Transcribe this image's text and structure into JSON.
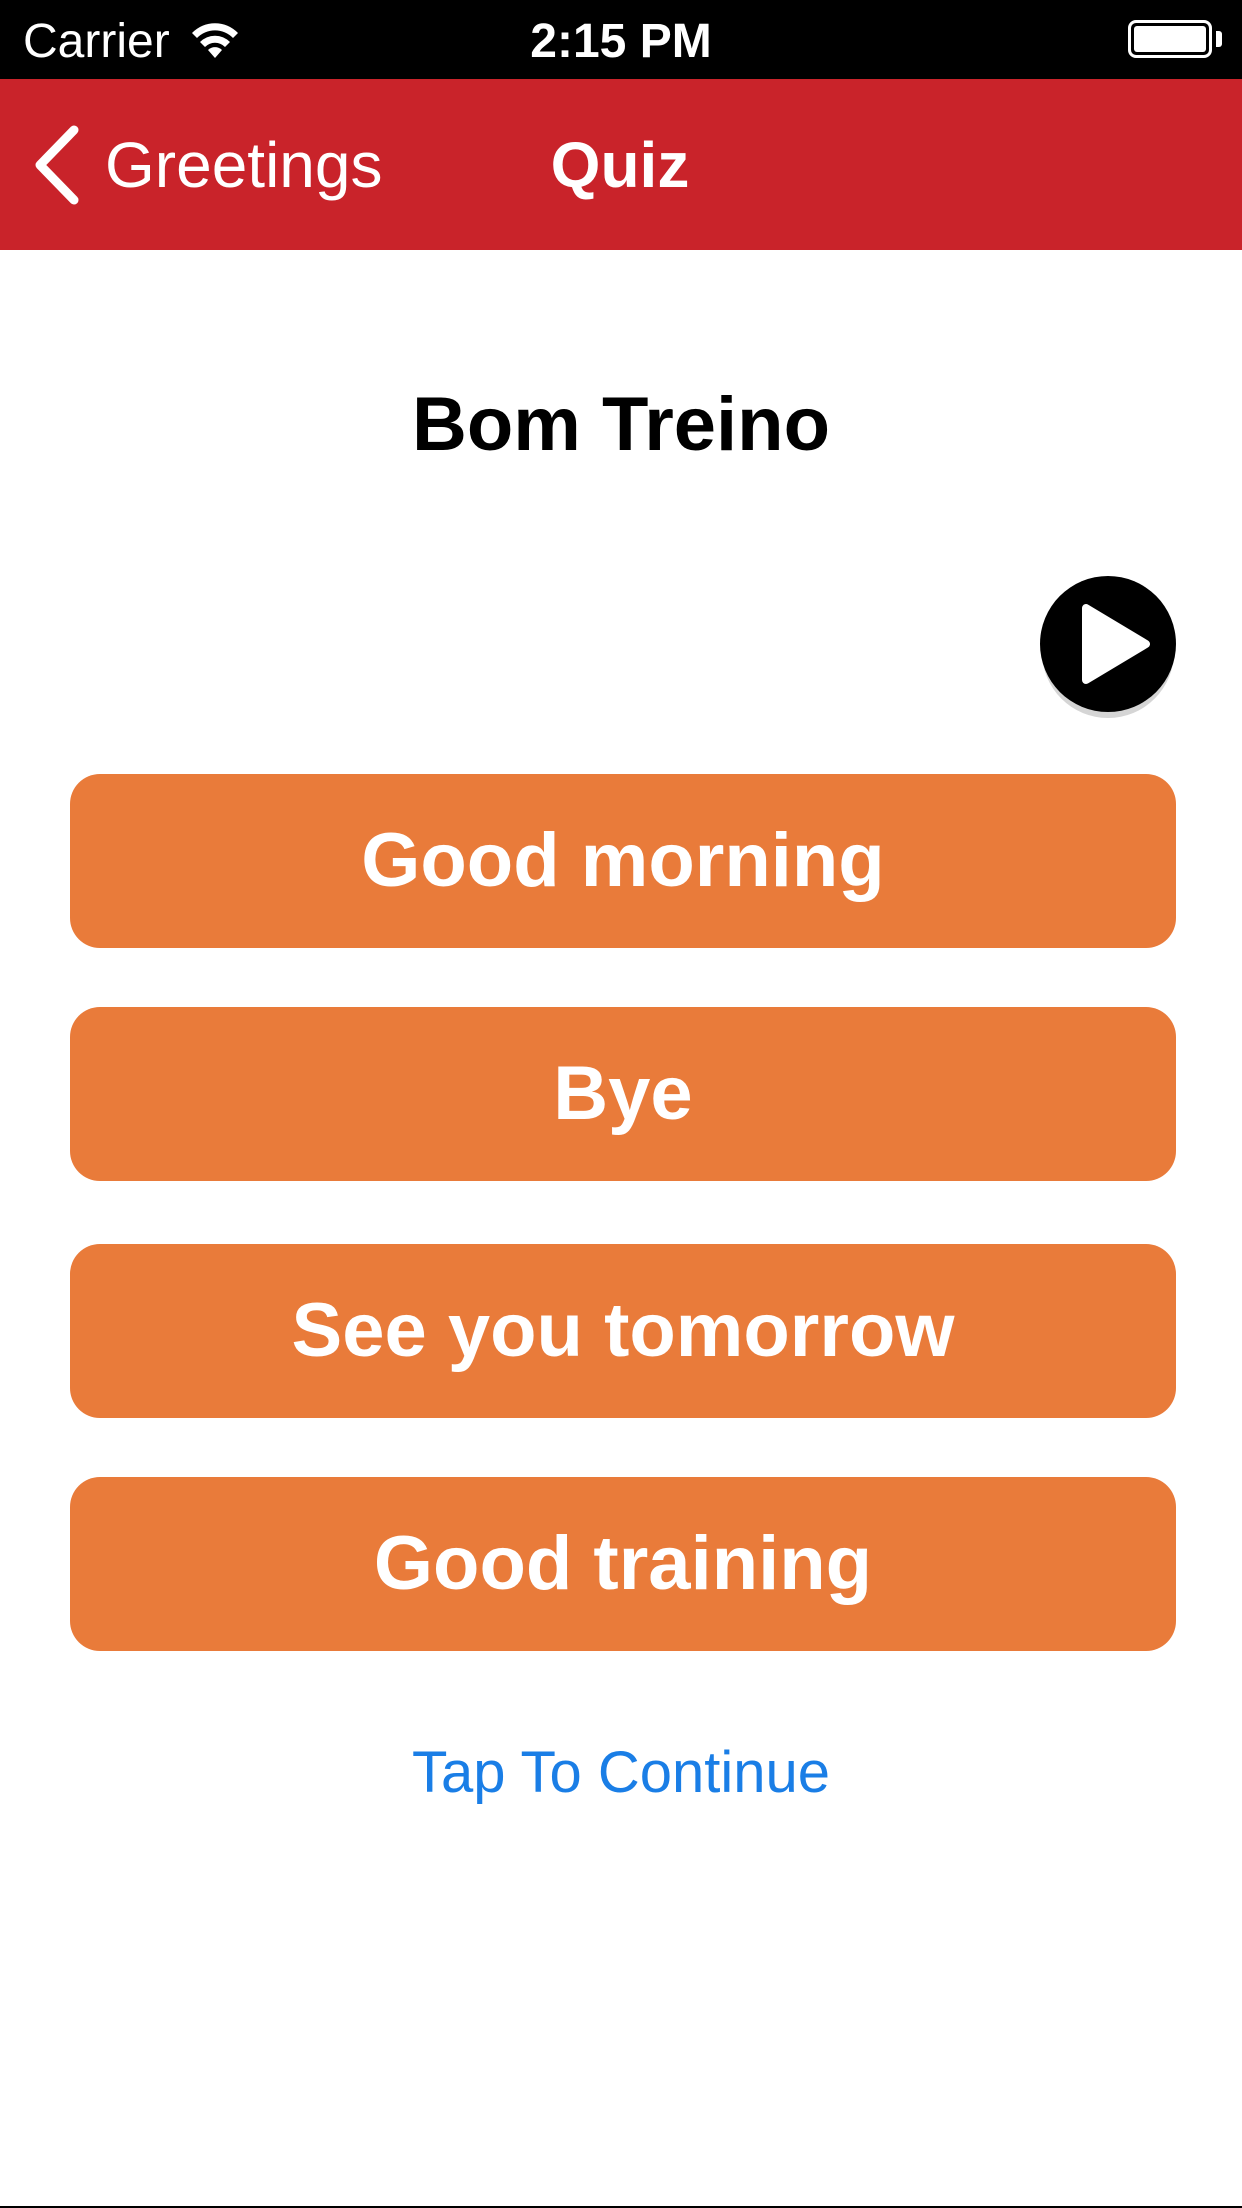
{
  "status_bar": {
    "carrier": "Carrier",
    "time": "2:15 PM",
    "wifi_icon": "wifi-icon",
    "battery_icon": "battery-icon"
  },
  "nav": {
    "back_label": "Greetings",
    "back_icon": "chevron-left-icon",
    "title": "Quiz",
    "color": "#c9232a"
  },
  "quiz": {
    "question": "Bom Treino",
    "play_icon": "play-icon",
    "answers": [
      "Good morning",
      "Bye",
      "See you tomorrow",
      "Good training"
    ],
    "answer_color": "#e97b3a",
    "continue_label": "Tap To Continue",
    "continue_color": "#1a7ee6"
  }
}
